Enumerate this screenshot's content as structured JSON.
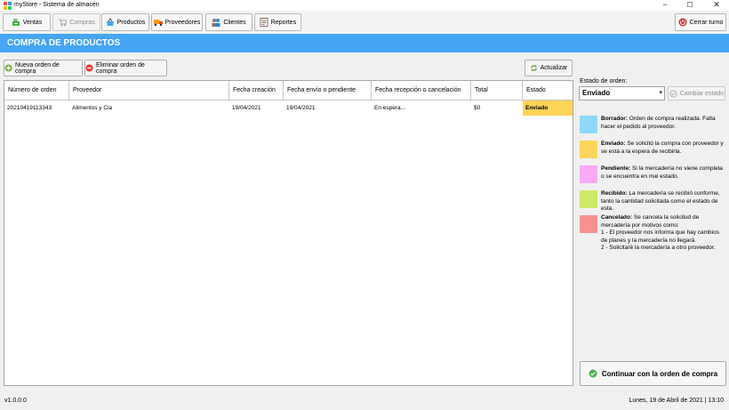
{
  "window": {
    "title": "myStore - Sistema de almacén",
    "minimize_icon": "−",
    "maximize_icon": "☐",
    "close_icon": "✕"
  },
  "toolbar": {
    "ventas": "Ventas",
    "compras": "Compras",
    "productos": "Productos",
    "proveedores": "Proveedores",
    "clientes": "Clientes",
    "reportes": "Reportes",
    "logout": "Cerrar turno"
  },
  "header": {
    "title": "COMPRA DE PRODUCTOS"
  },
  "actions": {
    "new_order": "Nueva orden de compra",
    "delete_order": "Eliminar orden de compra",
    "refresh": "Actualizar"
  },
  "table": {
    "columns": [
      "Número de orden",
      "Proveedor",
      "Fecha creación",
      "Fecha envío o pendiente",
      "Fecha recepción o cancelación",
      "Total",
      "Estado"
    ],
    "rows": [
      [
        "20210419113343",
        "Alimentos y Cia",
        "19/04/2021",
        "19/04/2021",
        "En espera...",
        "$0",
        "Enviado"
      ]
    ]
  },
  "status_panel": {
    "label": "Estado de orden:",
    "selected": "Enviado",
    "dropdown_arrow": "▾",
    "change_button": "Cambiar estado"
  },
  "legend": [
    {
      "name": "Borrador:",
      "text": " Orden de compra realizada. Falta hacer el pedido al proveedor.",
      "color": "#8ed8fa"
    },
    {
      "name": "Enviado:",
      "text": " Se solicitó la compra con proveedor y se está a la espera de recibirla.",
      "color": "#fed459"
    },
    {
      "name": "Pendiente:",
      "text": " Si la mercadería no viene completa o se encuentra en mal estado.",
      "color": "#faa9f6"
    },
    {
      "name": "Recibido:",
      "text": " La mercadería se recibió conforme, tanto la cantidad solicitada como el estado de esta.",
      "color": "#cdea68"
    },
    {
      "name": "Cancelado:",
      "text": " Se cancela la solicitud de mercadería por motivos como:",
      "lines": [
        "1 - El proveedor nos informa que hay cambios de planes y la mercadería no llegará.",
        "2 - Solicitaré la mercadería a otro proveedor."
      ],
      "color": "#f69291"
    }
  ],
  "continue_button": "Continuar con la orden de compra",
  "statusbar": {
    "version": "v1.0.0.0",
    "datetime": "Lunes, 19 de Abril de 2021 | 13:10"
  }
}
